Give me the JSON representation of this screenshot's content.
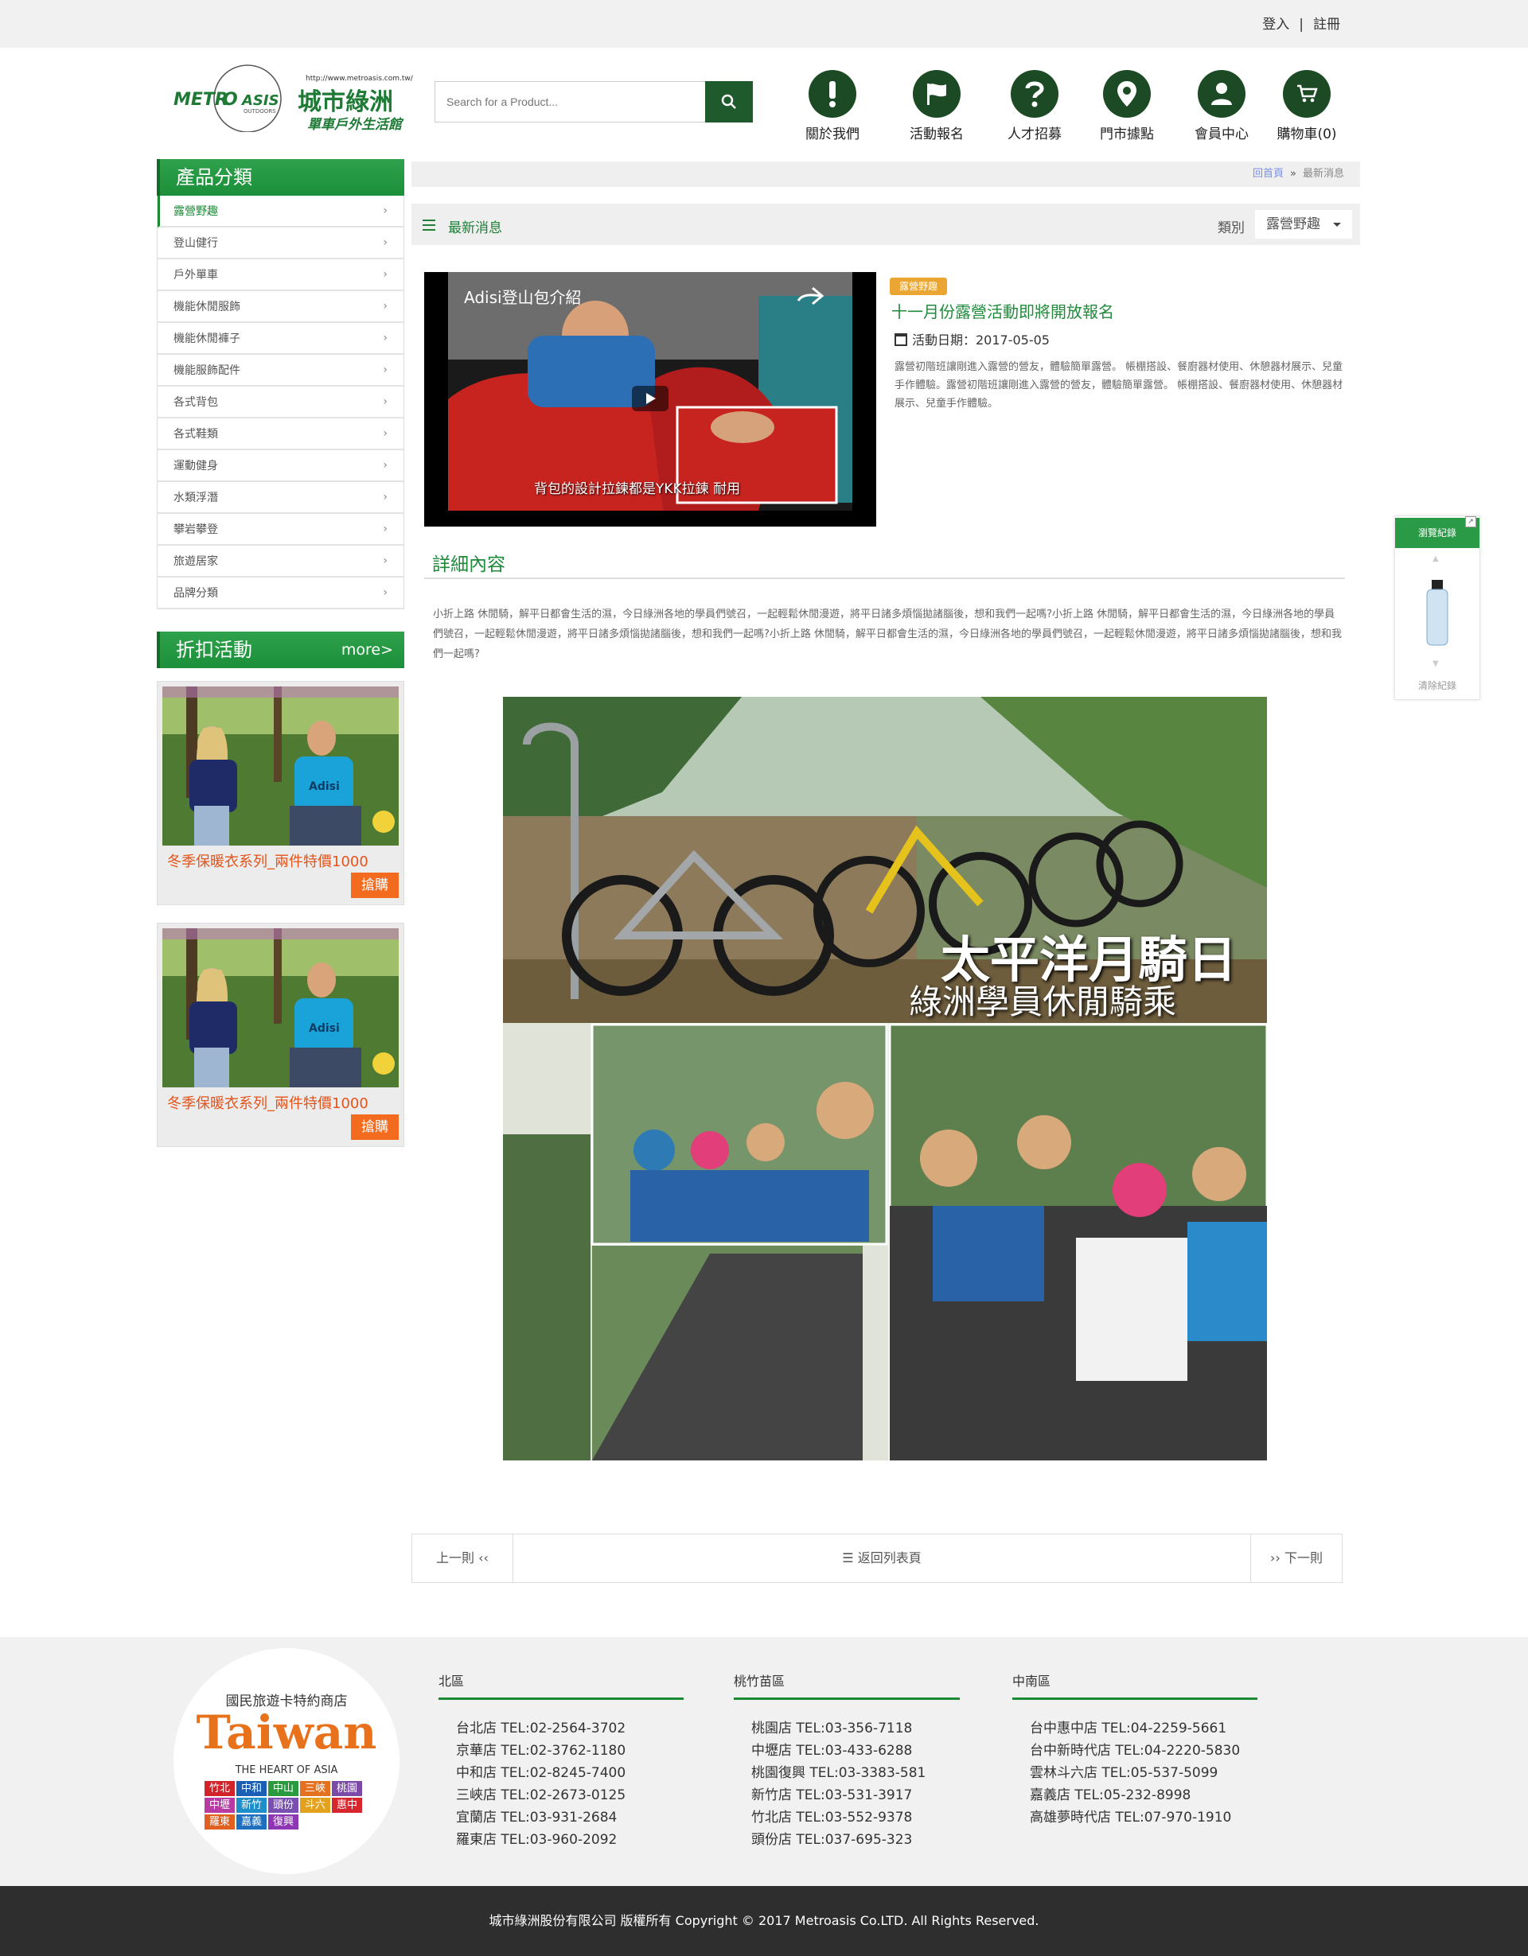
{
  "topbar": {
    "login": "登入",
    "divider": "|",
    "register": "註冊"
  },
  "header": {
    "logo_en": "METROASIS",
    "logo_url": "http://www.metroasis.com.tw/",
    "logo_zh": "城市綠洲",
    "logo_tagline": "單車戶外生活館",
    "logo_outdoors": "OUTDOORS",
    "search_placeholder": "Search for a Product...",
    "nav": [
      "關於我們",
      "活動報名",
      "人才招募",
      "門市據點",
      "會員中心",
      "購物車(0)"
    ]
  },
  "sidebar": {
    "title": "產品分類",
    "items": [
      "露營野趣",
      "登山健行",
      "戶外單車",
      "機能休閒服飾",
      "機能休閒褲子",
      "機能服飾配件",
      "各式背包",
      "各式鞋類",
      "運動健身",
      "水類浮潛",
      "攀岩攀登",
      "旅遊居家",
      "品牌分類"
    ],
    "active_index": 0,
    "promo_title": "折扣活動",
    "promo_more": "more>",
    "promos": [
      {
        "title": "冬季保暖衣系列_兩件特價1000",
        "button": "搶購"
      },
      {
        "title": "冬季保暖衣系列_兩件特價1000",
        "button": "搶購"
      }
    ]
  },
  "breadcrumb": {
    "home": "回首頁",
    "sep": "»",
    "current": "最新消息"
  },
  "newsbar": {
    "title": "最新消息",
    "category_label": "類別",
    "category_value": "露營野趣"
  },
  "video": {
    "title": "Adisi登山包介紹",
    "caption": "背包的設計拉鍊都是YKK拉鍊 耐用"
  },
  "event": {
    "tag": "露營野趣",
    "title": "十一月份露營活動即將開放報名",
    "date": "活動日期：2017-05-05",
    "description": "露營初階班讓剛進入露營的營友，體驗簡單露營。 帳棚搭設、餐廚器材使用、休憩器材展示、兒童手作體驗。露營初階班讓剛進入露營的營友，體驗簡單露營。 帳棚搭設、餐廚器材使用、休憩器材展示、兒童手作體驗。"
  },
  "detail": {
    "heading": "詳細內容",
    "text": "小折上路 休閒騎，解平日都會生活的濕，今日綠洲各地的學員們號召，一起輕鬆休閒漫遊，將平日諸多煩惱拋諸腦後，想和我們一起嗎?小折上路 休閒騎，解平日都會生活的濕，今日綠洲各地的學員們號召，一起輕鬆休閒漫遊，將平日諸多煩惱拋諸腦後，想和我們一起嗎?小折上路 休閒騎，解平日都會生活的濕，今日綠洲各地的學員們號召，一起輕鬆休閒漫遊，將平日諸多煩惱拋諸腦後，想和我們一起嗎?",
    "photo_title": "太平洋月騎日",
    "photo_subtitle": "綠洲學員休閒騎乘"
  },
  "pager": {
    "prev": "上一則",
    "back": "返回列表頁",
    "next": "下一則"
  },
  "history": {
    "title": "瀏覽紀錄",
    "clear": "清除紀錄"
  },
  "footer": {
    "badge_top": "國民旅遊卡特約商店",
    "badge_main": "Taiwan",
    "badge_sub": "THE HEART OF ASIA",
    "cities": [
      {
        "name": "竹北",
        "color": "#d3232a"
      },
      {
        "name": "中和",
        "color": "#1b5fb5"
      },
      {
        "name": "中山",
        "color": "#2b9a3f"
      },
      {
        "name": "三峽",
        "color": "#e3711d"
      },
      {
        "name": "桃園",
        "color": "#7b4aa6"
      },
      {
        "name": "中壢",
        "color": "#b83aa3"
      },
      {
        "name": "新竹",
        "color": "#1d8ec9"
      },
      {
        "name": "頭份",
        "color": "#7a4fb2"
      },
      {
        "name": "斗六",
        "color": "#e3a21d"
      },
      {
        "name": "惠中",
        "color": "#d8262e"
      },
      {
        "name": "羅東",
        "color": "#e2601f"
      },
      {
        "name": "嘉義",
        "color": "#1e6fc0"
      },
      {
        "name": "復興",
        "color": "#8e37b5"
      }
    ],
    "columns": [
      {
        "title": "北區",
        "lines": [
          "台北店  TEL:02-2564-3702",
          "京華店  TEL:02-3762-1180",
          "中和店  TEL:02-8245-7400",
          "三峽店  TEL:02-2673-0125",
          "宜蘭店  TEL:03-931-2684",
          "羅東店  TEL:03-960-2092"
        ]
      },
      {
        "title": "桃竹苗區",
        "lines": [
          "桃園店  TEL:03-356-7118",
          "中壢店  TEL:03-433-6288",
          "桃園復興  TEL:03-3383-581",
          "新竹店  TEL:03-531-3917",
          "竹北店  TEL:03-552-9378",
          "頭份店  TEL:037-695-323"
        ]
      },
      {
        "title": "中南區",
        "lines": [
          "台中惠中店  TEL:04-2259-5661",
          "台中新時代店 TEL:04-2220-5830",
          "雲林斗六店 TEL:05-537-5099",
          "嘉義店 TEL:05-232-8998",
          "高雄夢時代店 TEL:07-970-1910"
        ]
      }
    ],
    "copyright": "城市綠洲股份有限公司 版權所有 Copyright © 2017 Metroasis Co.LTD. All Rights Reserved."
  },
  "colors": {
    "brand_green": "#1a8a35",
    "dark_green": "#1c4a24",
    "promo_orange": "#f26b1f",
    "tag_orange": "#eaa631"
  }
}
